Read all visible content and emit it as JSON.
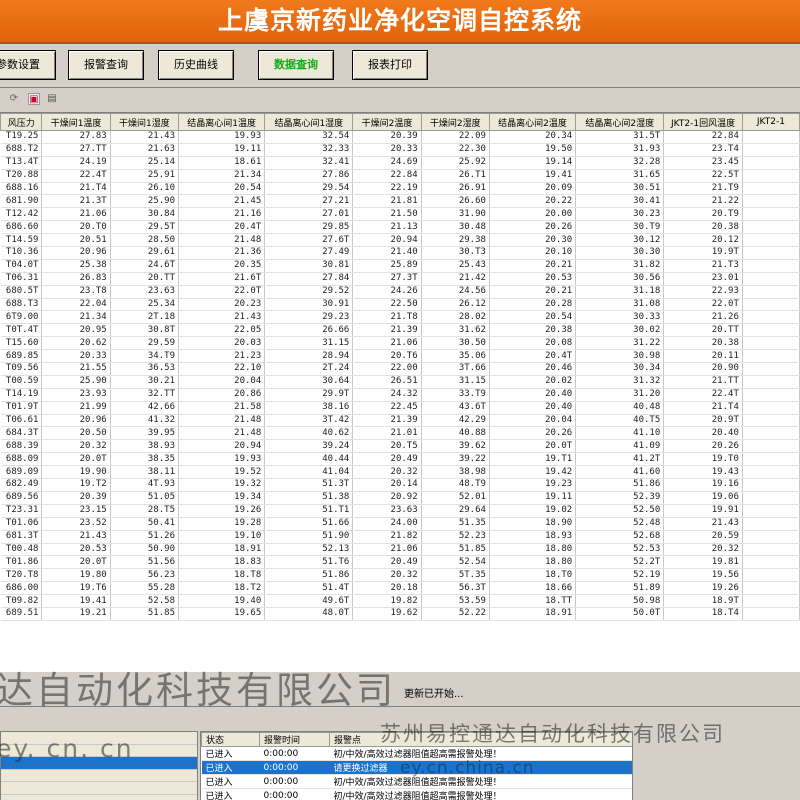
{
  "app": {
    "title": "上虞京新药业净化空调自控系统"
  },
  "toolbar": {
    "buttons": [
      {
        "label": "参数设置",
        "active": false
      },
      {
        "label": "报警查询",
        "active": false
      },
      {
        "label": "历史曲线",
        "active": false
      },
      {
        "label": "数据查询",
        "active": true
      },
      {
        "label": "报表打印",
        "active": false
      }
    ],
    "active_color": "#18a818"
  },
  "icons": [
    "refresh-icon",
    "chart-icon",
    "export-icon"
  ],
  "grid": {
    "columns": [
      "风压力",
      "干燥间1温度",
      "干燥间1湿度",
      "结晶离心间1温度",
      "结晶离心间1湿度",
      "干燥间2温度",
      "干燥间2湿度",
      "结晶离心间2温度",
      "结晶离心间2湿度",
      "JKT2-1回风温度",
      "JKT2-1"
    ],
    "rows": [
      [
        "T19.25",
        "27.83",
        "21.43",
        "19.93",
        "32.54",
        "20.39",
        "22.09",
        "20.34",
        "31.5T",
        "22.84"
      ],
      [
        "688.T2",
        "27.TT",
        "21.63",
        "19.11",
        "32.33",
        "20.33",
        "22.30",
        "19.50",
        "31.93",
        "23.T4"
      ],
      [
        "T13.4T",
        "24.19",
        "25.14",
        "18.61",
        "32.41",
        "24.69",
        "25.92",
        "19.14",
        "32.28",
        "23.45"
      ],
      [
        "T20.88",
        "22.4T",
        "25.91",
        "21.34",
        "27.86",
        "22.84",
        "26.T1",
        "19.41",
        "31.65",
        "22.5T"
      ],
      [
        "688.16",
        "21.T4",
        "26.10",
        "20.54",
        "29.54",
        "22.19",
        "26.91",
        "20.09",
        "30.51",
        "21.T9"
      ],
      [
        "681.90",
        "21.3T",
        "25.90",
        "21.45",
        "27.21",
        "21.81",
        "26.60",
        "20.22",
        "30.41",
        "21.22"
      ],
      [
        "T12.42",
        "21.06",
        "30.84",
        "21.16",
        "27.01",
        "21.50",
        "31.90",
        "20.00",
        "30.23",
        "20.T9"
      ],
      [
        "686.60",
        "20.T0",
        "29.5T",
        "20.4T",
        "29.85",
        "21.13",
        "30.48",
        "20.26",
        "30.T9",
        "20.38"
      ],
      [
        "T14.59",
        "20.51",
        "28.50",
        "21.48",
        "27.6T",
        "20.94",
        "29.38",
        "20.30",
        "30.12",
        "20.12"
      ],
      [
        "T10.36",
        "20.96",
        "29.61",
        "21.36",
        "27.49",
        "21.40",
        "30.T3",
        "20.10",
        "30.30",
        "19.9T"
      ],
      [
        "T04.0T",
        "25.38",
        "24.6T",
        "20.35",
        "30.81",
        "25.89",
        "25.43",
        "20.21",
        "31.82",
        "21.T3"
      ],
      [
        "T06.31",
        "26.83",
        "20.TT",
        "21.6T",
        "27.84",
        "27.3T",
        "21.42",
        "20.53",
        "30.56",
        "23.01"
      ],
      [
        "680.5T",
        "23.T8",
        "23.63",
        "22.0T",
        "29.52",
        "24.26",
        "24.56",
        "20.21",
        "31.18",
        "22.93"
      ],
      [
        "688.T3",
        "22.04",
        "25.34",
        "20.23",
        "30.91",
        "22.50",
        "26.12",
        "20.28",
        "31.08",
        "22.0T"
      ],
      [
        "6T9.00",
        "21.34",
        "2T.18",
        "21.43",
        "29.23",
        "21.T8",
        "28.02",
        "20.54",
        "30.33",
        "21.26"
      ],
      [
        "T0T.4T",
        "20.95",
        "30.8T",
        "22.05",
        "26.66",
        "21.39",
        "31.62",
        "20.38",
        "30.02",
        "20.TT"
      ],
      [
        "T15.60",
        "20.62",
        "29.59",
        "20.03",
        "31.15",
        "21.06",
        "30.50",
        "20.08",
        "31.22",
        "20.38"
      ],
      [
        "689.85",
        "20.33",
        "34.T9",
        "21.23",
        "28.94",
        "20.T6",
        "35.06",
        "20.4T",
        "30.98",
        "20.11"
      ],
      [
        "T09.56",
        "21.55",
        "36.53",
        "22.10",
        "2T.24",
        "22.00",
        "3T.66",
        "20.46",
        "30.34",
        "20.90"
      ],
      [
        "T00.59",
        "25.90",
        "30.21",
        "20.04",
        "30.64",
        "26.51",
        "31.15",
        "20.02",
        "31.32",
        "21.TT"
      ],
      [
        "T14.19",
        "23.93",
        "32.TT",
        "20.86",
        "29.9T",
        "24.32",
        "33.T9",
        "20.40",
        "31.20",
        "22.4T"
      ],
      [
        "T01.9T",
        "21.99",
        "42.66",
        "21.58",
        "38.16",
        "22.45",
        "43.6T",
        "20.40",
        "40.48",
        "21.T4"
      ],
      [
        "T06.61",
        "20.96",
        "41.32",
        "21.48",
        "3T.42",
        "21.39",
        "42.29",
        "20.04",
        "40.T5",
        "20.9T"
      ],
      [
        "684.3T",
        "20.50",
        "39.95",
        "21.48",
        "40.62",
        "21.01",
        "40.88",
        "20.26",
        "41.10",
        "20.40"
      ],
      [
        "688.39",
        "20.32",
        "38.93",
        "20.94",
        "39.24",
        "20.T5",
        "39.62",
        "20.0T",
        "41.09",
        "20.26"
      ],
      [
        "688.09",
        "20.0T",
        "38.35",
        "19.93",
        "40.44",
        "20.49",
        "39.22",
        "19.T1",
        "41.2T",
        "19.T0"
      ],
      [
        "689.09",
        "19.90",
        "38.11",
        "19.52",
        "41.04",
        "20.32",
        "38.98",
        "19.42",
        "41.60",
        "19.43"
      ],
      [
        "682.49",
        "19.T2",
        "4T.93",
        "19.32",
        "51.3T",
        "20.14",
        "48.T9",
        "19.23",
        "51.86",
        "19.16"
      ],
      [
        "689.56",
        "20.39",
        "51.05",
        "19.34",
        "51.38",
        "20.92",
        "52.01",
        "19.11",
        "52.39",
        "19.06"
      ],
      [
        "T23.31",
        "23.15",
        "28.T5",
        "19.26",
        "51.T1",
        "23.63",
        "29.64",
        "19.02",
        "52.50",
        "19.91"
      ],
      [
        "T01.06",
        "23.52",
        "50.41",
        "19.28",
        "51.66",
        "24.00",
        "51.35",
        "18.90",
        "52.48",
        "21.43"
      ],
      [
        "681.3T",
        "21.43",
        "51.26",
        "19.10",
        "51.90",
        "21.82",
        "52.23",
        "18.93",
        "52.68",
        "20.59"
      ],
      [
        "T00.48",
        "20.53",
        "50.90",
        "18.91",
        "52.13",
        "21.06",
        "51.85",
        "18.80",
        "52.53",
        "20.32"
      ],
      [
        "T01.86",
        "20.0T",
        "51.56",
        "18.83",
        "51.T6",
        "20.49",
        "52.54",
        "18.80",
        "52.2T",
        "19.81"
      ],
      [
        "T20.T8",
        "19.80",
        "56.23",
        "18.T8",
        "51.86",
        "20.32",
        "5T.35",
        "18.T0",
        "52.19",
        "19.56"
      ],
      [
        "686.00",
        "19.T6",
        "55.28",
        "18.T2",
        "51.4T",
        "20.18",
        "56.3T",
        "18.66",
        "51.89",
        "19.26"
      ],
      [
        "T09.82",
        "19.41",
        "52.58",
        "19.40",
        "49.6T",
        "19.82",
        "53.59",
        "18.TT",
        "50.98",
        "18.9T"
      ],
      [
        "689.51",
        "19.21",
        "51.85",
        "19.65",
        "48.0T",
        "19.62",
        "52.22",
        "18.91",
        "50.0T",
        "18.T4"
      ]
    ]
  },
  "status": {
    "text": "更新已开始..."
  },
  "alarms": {
    "columns": [
      "状态",
      "报警时间",
      "报警点"
    ],
    "rows": [
      {
        "status": "已进入",
        "time": "0:00:00",
        "point": "初/中效/高效过滤器阻值超高需报警处理！",
        "selected": false
      },
      {
        "status": "已进入",
        "time": "0:00:00",
        "point": "请更换过滤器",
        "selected": true
      },
      {
        "status": "已进入",
        "time": "0:00:00",
        "point": "初/中效/高效过滤器阻值超高需报警处理！",
        "selected": false
      },
      {
        "status": "已进入",
        "time": "0:00:00",
        "point": "初/中效/高效过滤器阻值超高需报警处理！",
        "selected": false
      }
    ],
    "selected_color": "#1e73c8"
  },
  "watermarks": {
    "company_left": "达自动化科技有限公司",
    "url_left": "ey. cn. cn",
    "company_right": "苏州易控通达自动化科技有限公司",
    "url_right": "ey.cn.china.cn"
  }
}
